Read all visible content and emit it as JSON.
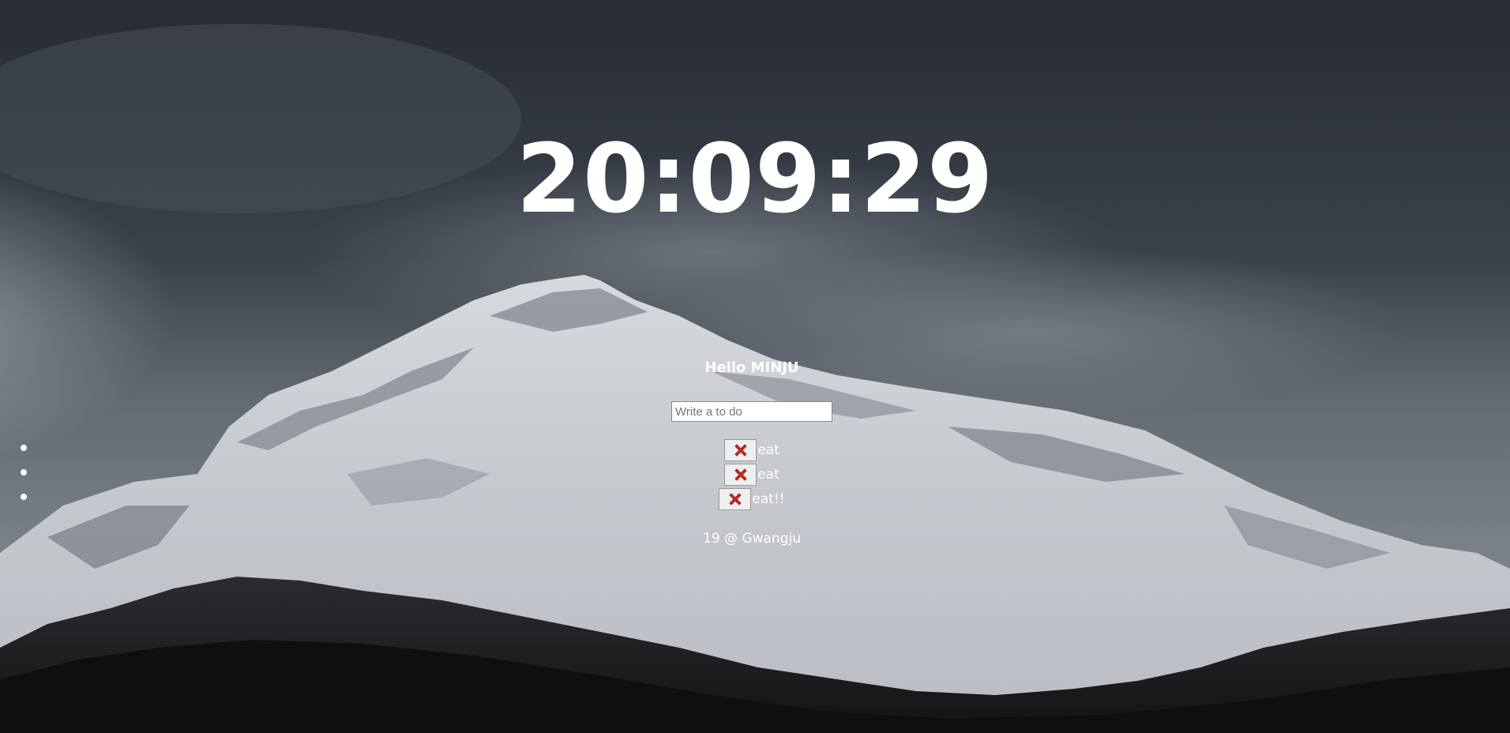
{
  "clock": {
    "time": "20:09:29"
  },
  "greeting": {
    "text": "Hello MINJU"
  },
  "todo_form": {
    "placeholder": "Write a to do"
  },
  "todos": [
    {
      "icon": "close-icon",
      "text": "eat"
    },
    {
      "icon": "close-icon",
      "text": "eat"
    },
    {
      "icon": "close-icon",
      "text": "eat!!"
    }
  ],
  "weather": {
    "text": "19 @ Gwangju"
  },
  "colors": {
    "text": "#ffffff",
    "delete_icon": "#e0251b"
  }
}
